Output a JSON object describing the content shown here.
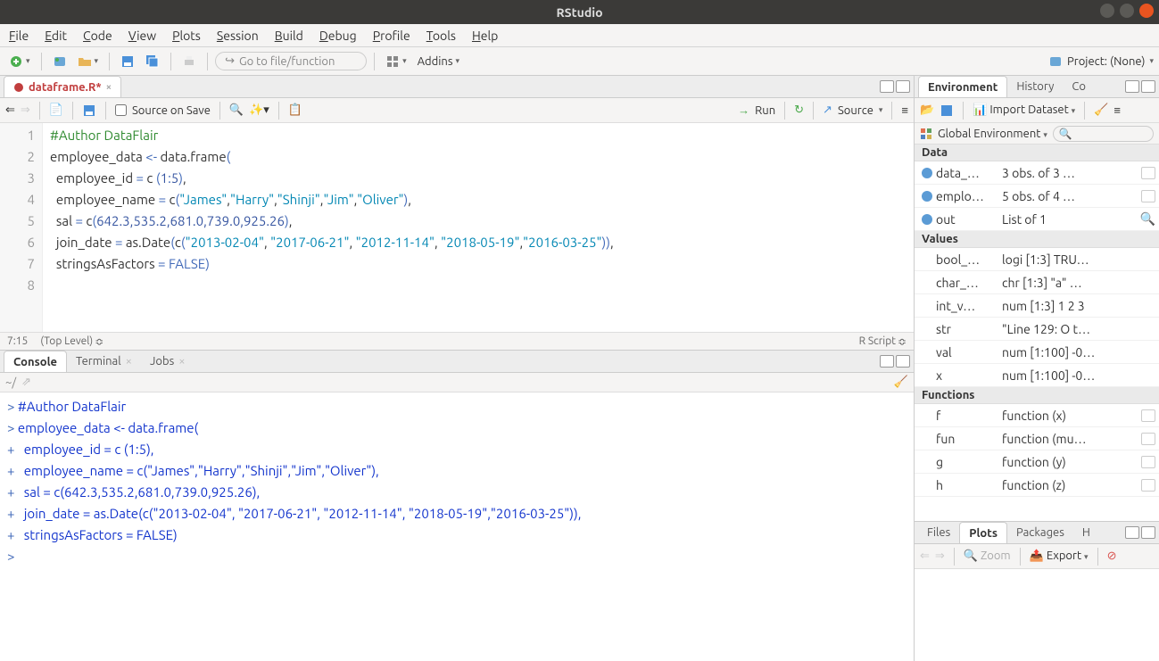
{
  "title": "RStudio",
  "menus": [
    "File",
    "Edit",
    "Code",
    "View",
    "Plots",
    "Session",
    "Build",
    "Debug",
    "Profile",
    "Tools",
    "Help"
  ],
  "toolbar": {
    "goto_placeholder": "Go to file/function",
    "addins": "Addins",
    "project_label": "Project: (None)"
  },
  "source": {
    "tab": "dataframe.R*",
    "source_on_save": "Source on Save",
    "run": "Run",
    "source_btn": "Source",
    "status_pos": "7:15",
    "status_scope": "(Top Level)",
    "status_lang": "R Script",
    "lines": [
      1,
      2,
      3,
      4,
      5,
      6,
      7,
      8
    ]
  },
  "code": {
    "l1": "#Author DataFlair",
    "l2a": "employee_data ",
    "l2b": "<-",
    "l2c": " data.frame",
    "l2p": "(",
    "l3a": "  employee_id ",
    "l3b": "=",
    "l3c": " c ",
    "l3p": "(",
    "l3n1": "1",
    "l3col": ":",
    "l3n2": "5",
    "l3q": ")",
    "l3comma": ",",
    "l4a": "  employee_name ",
    "l4b": "=",
    "l4c": " c",
    "l4p": "(",
    "l4s1": "\"James\"",
    "l4s2": "\"Harry\"",
    "l4s3": "\"Shinji\"",
    "l4s4": "\"Jim\"",
    "l4s5": "\"Oliver\"",
    "l4q": ")",
    "l4comma": ",",
    "l5a": "  sal ",
    "l5b": "=",
    "l5c": " c",
    "l5p": "(",
    "l5n": "642.3,535.2,681.0,739.0,925.26",
    "l5q": ")",
    "l5comma": ",",
    "l6a": "  join_date ",
    "l6b": "=",
    "l6c": " as.Date",
    "l6p": "(",
    "l6c2": "c",
    "l6p2": "(",
    "l6s1": "\"2013-02-04\"",
    "l6s2": "\"2017-06-21\"",
    "l6s3": "\"2012-11-14\"",
    "l6s4": "\"2018-05-19\"",
    "l6s5": "\"2016-03-25\"",
    "l6q": "))",
    "l6comma": ",",
    "l7a": "  stringsAsFactors ",
    "l7b": "=",
    "l7c": " ",
    "l7v": "FALSE",
    "l7q": ")"
  },
  "console": {
    "tabs": [
      "Console",
      "Terminal",
      "Jobs"
    ],
    "prompt_path": "~/",
    "lines": [
      "> #Author DataFlair",
      "> employee_data <- data.frame(",
      "+   employee_id = c (1:5),",
      "+   employee_name = c(\"James\",\"Harry\",\"Shinji\",\"Jim\",\"Oliver\"),",
      "+   sal = c(642.3,535.2,681.0,739.0,925.26),",
      "+   join_date = as.Date(c(\"2013-02-04\", \"2017-06-21\", \"2012-11-14\", \"2018-05-19\",\"2016-03-25\")),",
      "+   stringsAsFactors = FALSE)",
      "> "
    ]
  },
  "env": {
    "tabs": [
      "Environment",
      "History",
      "Co"
    ],
    "import": "Import Dataset",
    "scope": "Global Environment",
    "sections": {
      "Data": [
        {
          "name": "data_…",
          "val": "3 obs. of  3 …",
          "icon": true,
          "dot": true
        },
        {
          "name": "emplo…",
          "val": "5 obs. of  4 …",
          "icon": true,
          "dot": true
        },
        {
          "name": "out",
          "val": "List of 1",
          "icon": "search",
          "dot": true
        }
      ],
      "Values": [
        {
          "name": "bool_…",
          "val": "logi [1:3] TRU…"
        },
        {
          "name": "char_…",
          "val": "chr [1:3] \"a\" …"
        },
        {
          "name": "int_v…",
          "val": "num [1:3] 1 2 3"
        },
        {
          "name": "str",
          "val": "\"Line 129: O t…"
        },
        {
          "name": "val",
          "val": "num [1:100] -0…"
        },
        {
          "name": "x",
          "val": "num [1:100] -0…"
        }
      ],
      "Functions": [
        {
          "name": "f",
          "val": "function (x)  ",
          "icon": true
        },
        {
          "name": "fun",
          "val": "function (mu…",
          "icon": true
        },
        {
          "name": "g",
          "val": "function (y)  ",
          "icon": true
        },
        {
          "name": "h",
          "val": "function (z)  ",
          "icon": true
        }
      ]
    }
  },
  "plots": {
    "tabs": [
      "Files",
      "Plots",
      "Packages",
      "H"
    ],
    "zoom": "Zoom",
    "export": "Export"
  }
}
